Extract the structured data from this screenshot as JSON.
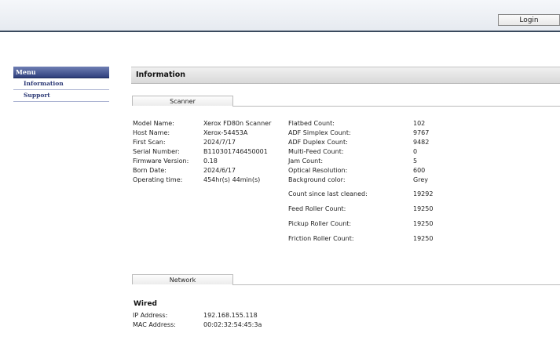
{
  "header": {
    "login_label": "Login"
  },
  "menu": {
    "title": "Menu",
    "items": [
      {
        "label": "Information"
      },
      {
        "label": "Support"
      }
    ]
  },
  "info": {
    "title": "Information"
  },
  "tabs": {
    "scanner": "Scanner",
    "network": "Network"
  },
  "scanner_left": [
    {
      "label": "Model Name:",
      "value": "Xerox FD80n Scanner"
    },
    {
      "label": "Host Name:",
      "value": "Xerox-54453A"
    },
    {
      "label": "First Scan:",
      "value": "2024/7/17"
    },
    {
      "label": "Serial Number:",
      "value": "B110301746450001"
    },
    {
      "label": "Firmware Version:",
      "value": "0.18"
    },
    {
      "label": "Born Date:",
      "value": "2024/6/17"
    },
    {
      "label": "Operating time:",
      "value": "454hr(s) 44min(s)"
    }
  ],
  "scanner_right": [
    {
      "label": "Flatbed Count:",
      "value": "102"
    },
    {
      "label": "ADF Simplex Count:",
      "value": "9767"
    },
    {
      "label": "ADF Duplex Count:",
      "value": "9482"
    },
    {
      "label": "Multi-Feed Count:",
      "value": "0"
    },
    {
      "label": "Jam Count:",
      "value": "5"
    },
    {
      "label": "Optical Resolution:",
      "value": "600"
    },
    {
      "label": "Background color:",
      "value": "Grey"
    },
    {
      "label": "Count since last cleaned:",
      "value": "19292"
    },
    {
      "label": "Feed Roller Count:",
      "value": "19250"
    },
    {
      "label": "Pickup Roller Count:",
      "value": "19250"
    },
    {
      "label": "Friction Roller Count:",
      "value": "19250"
    }
  ],
  "network": {
    "section_title": "Wired",
    "rows": [
      {
        "label": "IP Address:",
        "value": "192.168.155.118"
      },
      {
        "label": "MAC Address:",
        "value": "00:02:32:54:45:3a"
      }
    ]
  }
}
